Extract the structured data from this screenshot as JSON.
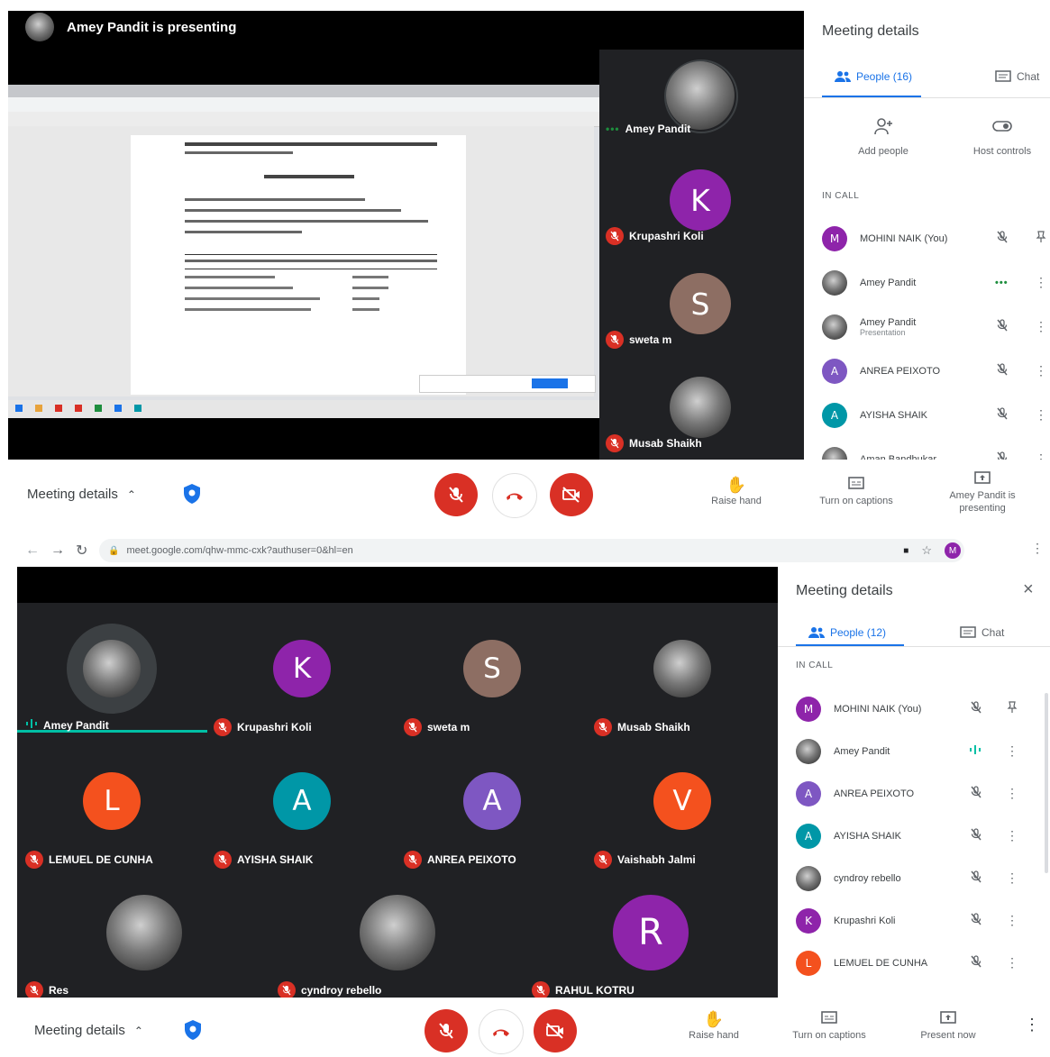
{
  "top": {
    "presenting_banner": "Amey Pandit is presenting",
    "tiles": [
      {
        "name": "Amey Pandit",
        "avatar": "photo",
        "speaking": true
      },
      {
        "name": "Krupashri Koli",
        "avatar": "K",
        "color": "#8e24aa",
        "muted": true
      },
      {
        "name": "sweta m",
        "avatar": "S",
        "color": "#8d6e63",
        "muted": true
      },
      {
        "name": "Musab Shaikh",
        "avatar": "photo",
        "muted": true
      }
    ],
    "sidebar": {
      "title": "Meeting details",
      "tabs": [
        {
          "label": "People (16)",
          "icon": "people-icon",
          "active": true
        },
        {
          "label": "Chat",
          "icon": "chat-icon",
          "active": false
        }
      ],
      "actions": [
        {
          "label": "Add people",
          "icon": "add-person-icon"
        },
        {
          "label": "Host controls",
          "icon": "host-controls-icon"
        }
      ],
      "in_call_label": "IN CALL",
      "people": [
        {
          "name": "MOHINI NAIK (You)",
          "avatar": "M",
          "color": "#8e24aa",
          "state": "muted",
          "extra": "pin-icon"
        },
        {
          "name": "Amey Pandit",
          "avatar": "photo",
          "state": "speaking"
        },
        {
          "name": "Amey Pandit",
          "sub": "Presentation",
          "avatar": "photo",
          "state": "muted"
        },
        {
          "name": "ANREA PEIXOTO",
          "avatar": "A",
          "color": "#7e57c2",
          "state": "muted"
        },
        {
          "name": "AYISHA SHAIK",
          "avatar": "A",
          "color": "#0097a7",
          "state": "muted"
        },
        {
          "name": "Aman Bandhukar",
          "avatar": "photo",
          "state": "muted"
        }
      ]
    },
    "bottom_bar": {
      "meeting_details": "Meeting details",
      "raise_hand": "Raise hand",
      "captions": "Turn on captions",
      "presenting": "Amey Pandit is presenting"
    }
  },
  "bottom": {
    "url": "meet.google.com/qhw-mmc-cxk?authuser=0&hl=en",
    "profile_initial": "M",
    "grid": [
      {
        "name": "Amey Pandit",
        "avatar": "photo",
        "speaking": true
      },
      {
        "name": "Krupashri Koli",
        "avatar": "K",
        "color": "#8e24aa",
        "muted": true
      },
      {
        "name": "sweta m",
        "avatar": "S",
        "color": "#8d6e63",
        "muted": true
      },
      {
        "name": "Musab Shaikh",
        "avatar": "photo",
        "muted": true
      },
      {
        "name": "LEMUEL DE CUNHA",
        "avatar": "L",
        "color": "#f4511e",
        "muted": true
      },
      {
        "name": "AYISHA SHAIK",
        "avatar": "A",
        "color": "#0097a7",
        "muted": true
      },
      {
        "name": "ANREA PEIXOTO",
        "avatar": "A",
        "color": "#7e57c2",
        "muted": true
      },
      {
        "name": "Vaishabh Jalmi",
        "avatar": "V",
        "color": "#f4511e",
        "muted": true
      },
      {
        "name": "Res",
        "avatar": "photo",
        "muted": true
      },
      {
        "name": "cyndroy rebello",
        "avatar": "photo",
        "muted": true
      },
      {
        "name": "RAHUL KOTRU",
        "avatar": "R",
        "color": "#8e24aa",
        "muted": true
      }
    ],
    "sidebar": {
      "title": "Meeting details",
      "tabs": [
        {
          "label": "People (12)",
          "icon": "people-icon",
          "active": true
        },
        {
          "label": "Chat",
          "icon": "chat-icon",
          "active": false
        }
      ],
      "in_call_label": "IN CALL",
      "people": [
        {
          "name": "MOHINI NAIK (You)",
          "avatar": "M",
          "color": "#8e24aa",
          "state": "muted",
          "extra": "pin-icon"
        },
        {
          "name": "Amey Pandit",
          "avatar": "photo",
          "state": "speaking"
        },
        {
          "name": "ANREA PEIXOTO",
          "avatar": "A",
          "color": "#7e57c2",
          "state": "muted"
        },
        {
          "name": "AYISHA SHAIK",
          "avatar": "A",
          "color": "#0097a7",
          "state": "muted"
        },
        {
          "name": "cyndroy rebello",
          "avatar": "photo",
          "state": "muted"
        },
        {
          "name": "Krupashri Koli",
          "avatar": "K",
          "color": "#8e24aa",
          "state": "muted"
        },
        {
          "name": "LEMUEL DE CUNHA",
          "avatar": "L",
          "color": "#f4511e",
          "state": "muted"
        }
      ]
    },
    "bottom_bar": {
      "meeting_details": "Meeting details",
      "raise_hand": "Raise hand",
      "captions": "Turn on captions",
      "present_now": "Present now"
    }
  },
  "colors": {
    "red": "#d93025",
    "blue": "#1a73e8",
    "dark": "#202124",
    "green": "#1e8e3e"
  }
}
